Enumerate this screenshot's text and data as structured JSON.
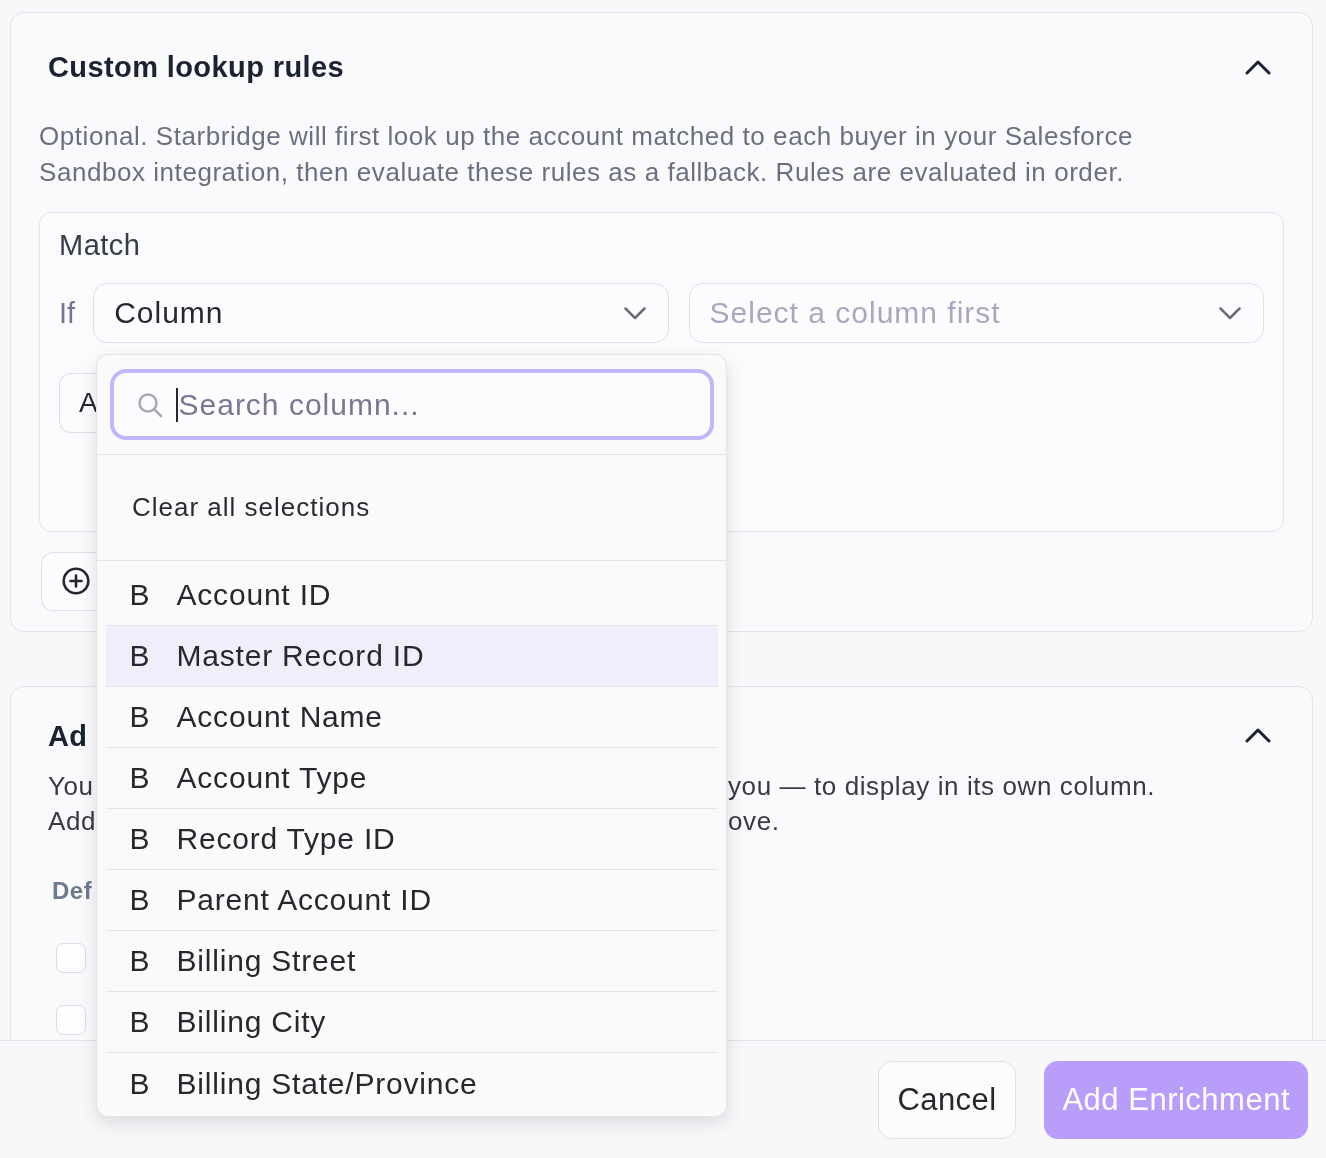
{
  "lookup_rules": {
    "title": "Custom lookup rules",
    "expanded": true,
    "description": "Optional. Starbridge will first look up the account matched to each buyer in your Salesforce Sandbox integration, then evaluate these rules as a fallback. Rules are evaluated in order.",
    "match": {
      "title": "Match",
      "condition": "If",
      "column_select": {
        "value": "Column"
      },
      "value_select": {
        "placeholder": "Select a column first"
      },
      "rule_button": {
        "label": "A"
      }
    }
  },
  "column_dropdown": {
    "search": {
      "placeholder": "Search column...",
      "focused": true
    },
    "clear_label": "Clear all selections",
    "options": [
      {
        "type_label": "B",
        "label": "Account ID",
        "highlighted": false
      },
      {
        "type_label": "B",
        "label": "Master Record ID",
        "highlighted": true
      },
      {
        "type_label": "B",
        "label": "Account Name",
        "highlighted": false
      },
      {
        "type_label": "B",
        "label": "Account Type",
        "highlighted": false
      },
      {
        "type_label": "B",
        "label": "Record Type ID",
        "highlighted": false
      },
      {
        "type_label": "B",
        "label": "Parent Account ID",
        "highlighted": false
      },
      {
        "type_label": "B",
        "label": "Billing Street",
        "highlighted": false
      },
      {
        "type_label": "B",
        "label": "Billing City",
        "highlighted": false
      },
      {
        "type_label": "B",
        "label": "Billing State/Province",
        "highlighted": false
      }
    ]
  },
  "enrichment_section": {
    "title": "Ad",
    "expanded": true,
    "description_lines": [
      {
        "start": "You",
        "end": "you — to display in its own column."
      },
      {
        "start": "Add",
        "end": "ove."
      }
    ],
    "field_label": "Def",
    "checkboxes": [
      {
        "checked": false
      },
      {
        "checked": false
      }
    ]
  },
  "footer": {
    "cancel": "Cancel",
    "submit": {
      "label": "Add Enrichment",
      "disabled": true
    }
  }
}
